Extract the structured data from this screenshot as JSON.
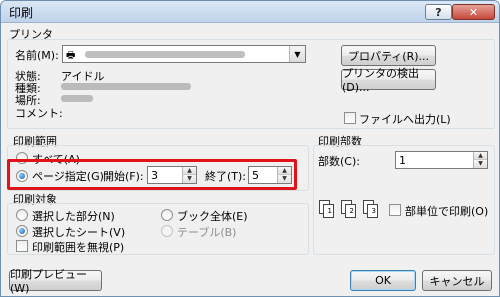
{
  "window": {
    "title": "印刷",
    "help_label": "?",
    "close_label": "✕"
  },
  "printer": {
    "group_title": "プリンタ",
    "name_label": "名前(M):",
    "status_label": "状態:",
    "status_value": "アイドル",
    "type_label": "種類:",
    "location_label": "場所:",
    "comment_label": "コメント:",
    "properties_button": "プロパティ(R)...",
    "find_printer_button": "プリンタの検出(D)...",
    "print_to_file_label": "ファイルへ出力(L)"
  },
  "range": {
    "group_title": "印刷範囲",
    "all_label": "すべて(A)",
    "pages_label": "ページ指定(G)",
    "from_label": "開始(F):",
    "from_value": "3",
    "to_label": "終了(T):",
    "to_value": "5"
  },
  "copies": {
    "group_title": "印刷部数",
    "count_label": "部数(C):",
    "count_value": "1",
    "collate_label": "部単位で印刷(O)"
  },
  "target": {
    "group_title": "印刷対象",
    "selection_label": "選択した部分(N)",
    "selected_sheets_label": "選択したシート(V)",
    "ignore_print_area_label": "印刷範囲を無視(P)",
    "entire_book_label": "ブック全体(E)",
    "table_label": "テーブル(B)"
  },
  "footer": {
    "preview_button": "印刷プレビュー(W)",
    "ok_button": "OK",
    "cancel_button": "キャンセル"
  },
  "colors": {
    "highlight_border": "#e0121a",
    "selected_radio": "#1a57a8"
  }
}
